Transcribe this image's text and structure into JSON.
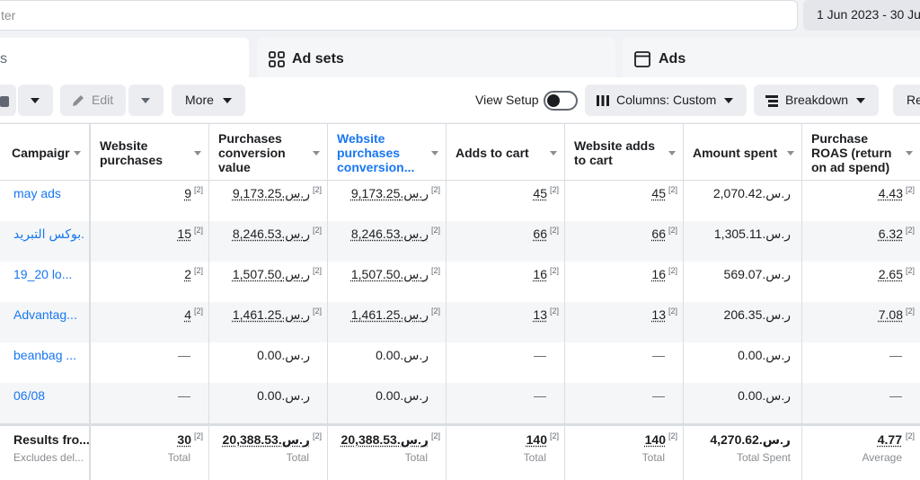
{
  "filter": {
    "placeholder_fragment": "ter"
  },
  "date_range": "1 Jun 2023 - 30 Jun",
  "tabs": [
    {
      "label": "s"
    },
    {
      "label": "Ad sets"
    },
    {
      "label": "Ads"
    }
  ],
  "toolbar": {
    "edit_label": "Edit",
    "more_label": "More",
    "view_setup_label": "View Setup",
    "columns_label": "Columns: Custom",
    "breakdown_label": "Breakdown",
    "report_fragment": "Re"
  },
  "columns": {
    "campaign": "Campaigr",
    "website_purchases": [
      "Website",
      "purchases"
    ],
    "purchases_conversion_value": [
      "Purchases",
      "conversion",
      "value"
    ],
    "website_purchases_conversion": [
      "Website",
      "purchases",
      "conversion..."
    ],
    "adds_to_cart": "Adds to cart",
    "website_adds_to_cart": [
      "Website adds",
      "to cart"
    ],
    "amount_spent": "Amount spent",
    "purchase_roas": [
      "Purchase",
      "ROAS (return",
      "on ad spend)"
    ]
  },
  "sup_marker": "[2]",
  "rows": [
    {
      "name": "may ads",
      "website_purchases": "9",
      "pcv": "ر.س.9,173.25",
      "wpcv": "ر.س.9,173.25",
      "adds_to_cart": "45",
      "website_adds": "45",
      "amount_spent": "ر.س.2,070.42",
      "roas": "4.43"
    },
    {
      "name": "بوكس التبريد...",
      "website_purchases": "15",
      "pcv": "ر.س.8,246.53",
      "wpcv": "ر.س.8,246.53",
      "adds_to_cart": "66",
      "website_adds": "66",
      "amount_spent": "ر.س.1,305.11",
      "roas": "6.32"
    },
    {
      "name": "19_20 lo...",
      "website_purchases": "2",
      "pcv": "ر.س.1,507.50",
      "wpcv": "ر.س.1,507.50",
      "adds_to_cart": "16",
      "website_adds": "16",
      "amount_spent": "ر.س.569.07",
      "roas": "2.65"
    },
    {
      "name": "Advantag...",
      "website_purchases": "4",
      "pcv": "ر.س.1,461.25",
      "wpcv": "ر.س.1,461.25",
      "adds_to_cart": "13",
      "website_adds": "13",
      "amount_spent": "ر.س.206.35",
      "roas": "7.08"
    },
    {
      "name": "beanbag ...",
      "website_purchases": "—",
      "pcv": "ر.س.0.00",
      "wpcv": "ر.س.0.00",
      "adds_to_cart": "—",
      "website_adds": "—",
      "amount_spent": "ر.س.0.00",
      "roas": "—"
    },
    {
      "name": "06/08",
      "website_purchases": "—",
      "pcv": "ر.س.0.00",
      "wpcv": "ر.س.0.00",
      "adds_to_cart": "—",
      "website_adds": "—",
      "amount_spent": "ر.س.0.00",
      "roas": "—"
    }
  ],
  "summary": {
    "title": "Results fro...",
    "subtitle": "Excludes del...",
    "website_purchases": "30",
    "website_purchases_sub": "Total",
    "pcv": "ر.س.20,388.53",
    "pcv_sub": "Total",
    "wpcv": "ر.س.20,388.53",
    "wpcv_sub": "Total",
    "adds_to_cart": "140",
    "adds_to_cart_sub": "Total",
    "website_adds": "140",
    "website_adds_sub": "Total",
    "amount_spent": "ر.س.4,270.62",
    "amount_spent_sub": "Total Spent",
    "roas": "4.77",
    "roas_sub": "Average"
  }
}
